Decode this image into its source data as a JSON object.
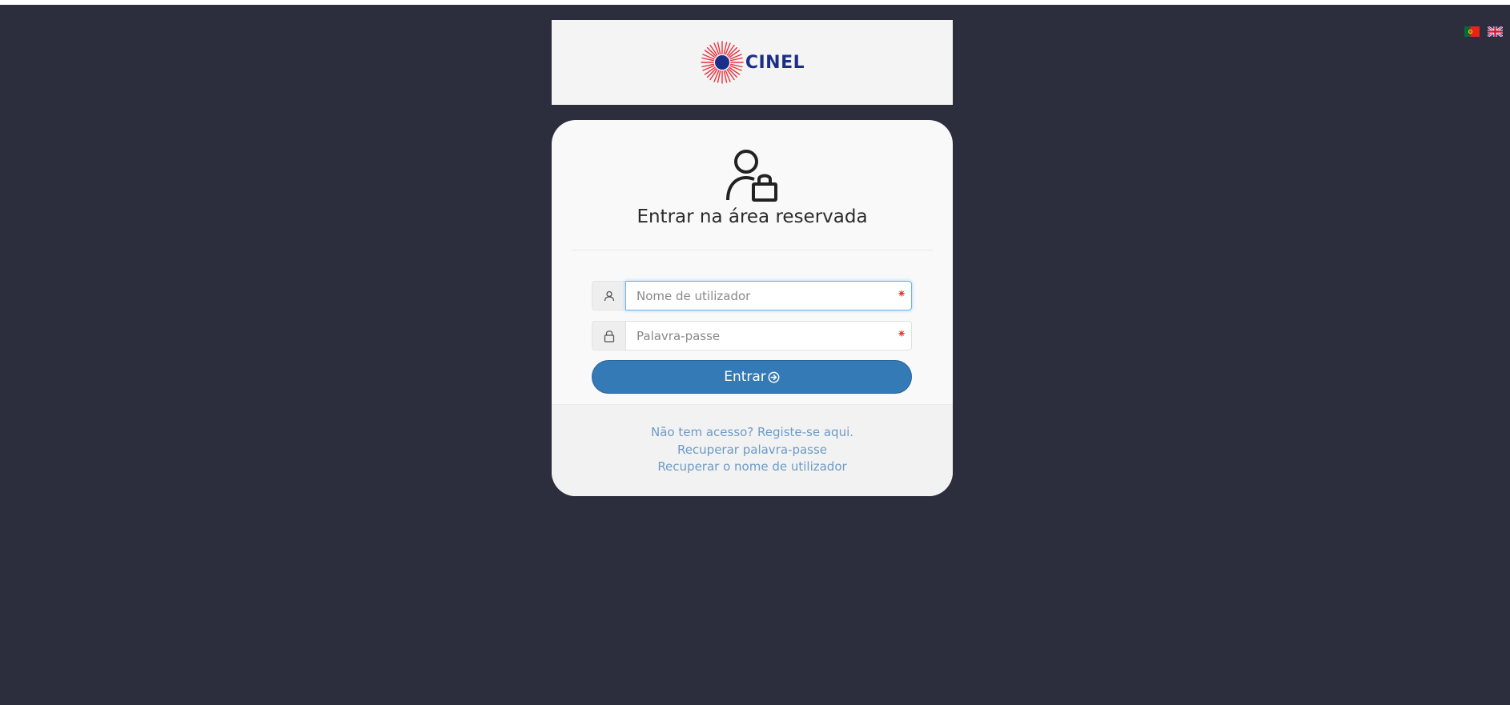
{
  "language_switcher": {
    "flags": [
      {
        "icon": "portugal-flag-icon",
        "language": "Português"
      },
      {
        "icon": "uk-flag-icon",
        "language": "English"
      }
    ]
  },
  "brand": {
    "name": "CINEL",
    "colors": {
      "primary": "#1c2f88",
      "accent": "#e8303b"
    }
  },
  "login": {
    "icon": "user-lock-icon",
    "title": "Entrar na área reservada",
    "username": {
      "placeholder": "Nome de utilizador",
      "value": "",
      "required_marker": "⁕",
      "icon": "user-icon"
    },
    "password": {
      "placeholder": "Palavra-passe",
      "value": "",
      "required_marker": "⁕",
      "icon": "lock-icon"
    },
    "submit_label": "Entrar",
    "submit_icon": "arrow-circle-right-icon",
    "colors": {
      "button": "#337ab7",
      "link": "#6c9bc8"
    }
  },
  "footer_links": {
    "register": "Não tem acesso? Registe-se aqui.",
    "recover_password": "Recuperar palavra-passe",
    "recover_username": "Recuperar o nome de utilizador"
  },
  "theme": {
    "background": "#2d2e3d"
  }
}
